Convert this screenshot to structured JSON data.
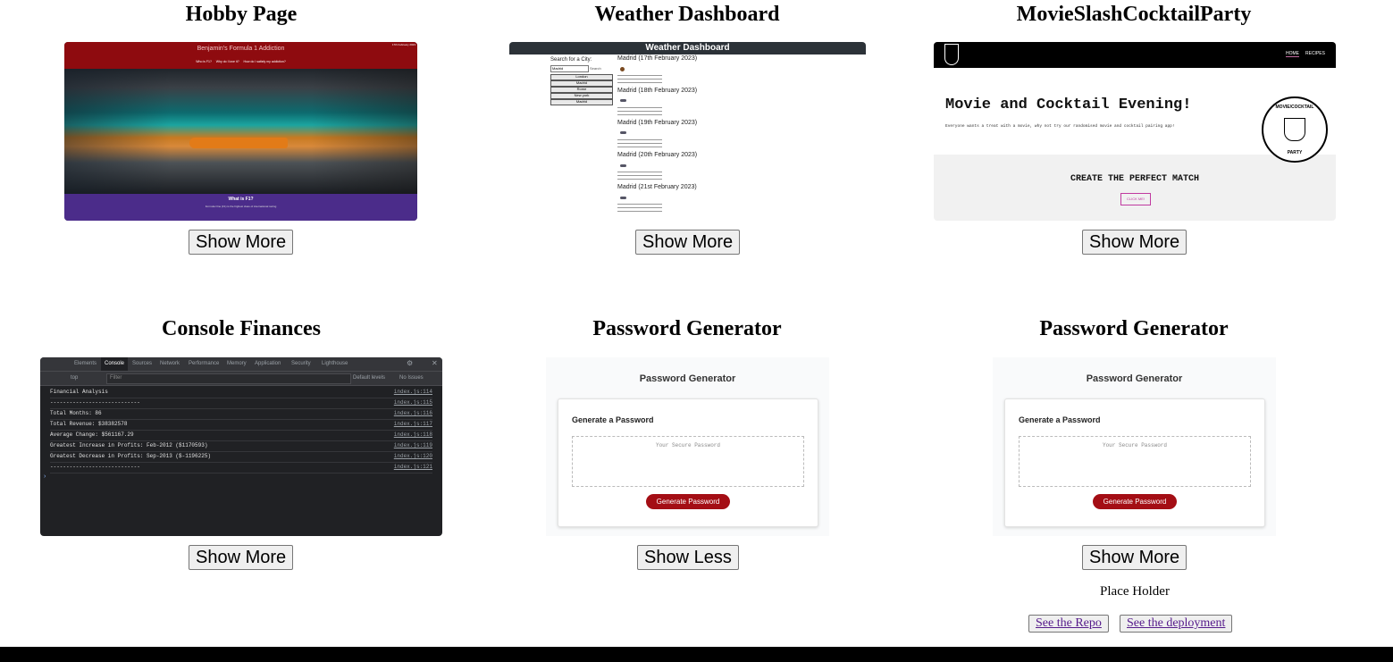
{
  "cards": [
    {
      "title": "Hobby Page",
      "button": "Show More",
      "thumb": {
        "site_title": "Benjamin's Formula 1 Addiction",
        "nav": [
          "Who is F1?",
          "Why do I love it?",
          "How do I satisfy my addiction?"
        ],
        "date": "17th February 2023",
        "section_title": "What is F1?",
        "section_text": "Formula One (F1) is the highest class of international racing"
      }
    },
    {
      "title": "Weather Dashboard",
      "button": "Show More",
      "thumb": {
        "header": "Weather Dashboard",
        "search_label": "Search for a City:",
        "search_value": "Madrid",
        "search_button": "Search",
        "cities": [
          "London",
          "Madrid",
          "Rome",
          "New york",
          "Madrid"
        ],
        "days": [
          "Madrid (17th February 2023)",
          "Madrid (18th February 2023)",
          "Madrid (19th February 2023)",
          "Madrid (20th February 2023)",
          "Madrid (21st February 2023)"
        ]
      }
    },
    {
      "title": "MovieSlashCocktailParty",
      "button": "Show More",
      "thumb": {
        "nav": [
          "HOME",
          "RECIPES"
        ],
        "heading": "Movie and Cocktail Evening!",
        "subtext": "Everyone wants a treat with a movie, why not try our randomised movie and cocktail pairing app!",
        "cta": "CREATE THE PERFECT MATCH",
        "cta_button": "CLICK ME!",
        "logo_top": "MOVIE/COCKTAIL",
        "logo_bottom": "PARTY"
      }
    },
    {
      "title": "Console Finances",
      "button": "Show More",
      "thumb": {
        "tabs": [
          "Elements",
          "Console",
          "Sources",
          "Network",
          "Performance",
          "Memory",
          "Application",
          "Security",
          "Lighthouse"
        ],
        "context": "top",
        "filter": "Filter",
        "levels": "Default levels",
        "issues": "No Issues",
        "lines": [
          {
            "text": "Financial Analysis",
            "src": "index.js:114"
          },
          {
            "text": "----------------------------",
            "src": "index.js:115"
          },
          {
            "text": "Total Months: 86",
            "src": "index.js:116"
          },
          {
            "text": "Total Revenue: $38382578",
            "src": "index.js:117"
          },
          {
            "text": "Average Change: $561167.29",
            "src": "index.js:118"
          },
          {
            "text": "Greatest Increase in Profits: Feb-2012 ($1170593)",
            "src": "index.js:119"
          },
          {
            "text": "Greatest Decrease in Profits: Sep-2013 ($-1196225)",
            "src": "index.js:120"
          },
          {
            "text": "----------------------------",
            "src": "index.js:121"
          }
        ]
      }
    },
    {
      "title": "Password Generator",
      "button": "Show Less",
      "thumb": {
        "header": "Password Generator",
        "subheader": "Generate a Password",
        "placeholder": "Your Secure Password",
        "generate": "Generate Password"
      }
    },
    {
      "title": "Password Generator",
      "button": "Show More",
      "thumb": {
        "header": "Password Generator",
        "subheader": "Generate a Password",
        "placeholder": "Your Secure Password",
        "generate": "Generate Password"
      },
      "details": {
        "text": "Place Holder",
        "repo": "See the Repo",
        "deployment": "See the deployment"
      }
    }
  ]
}
